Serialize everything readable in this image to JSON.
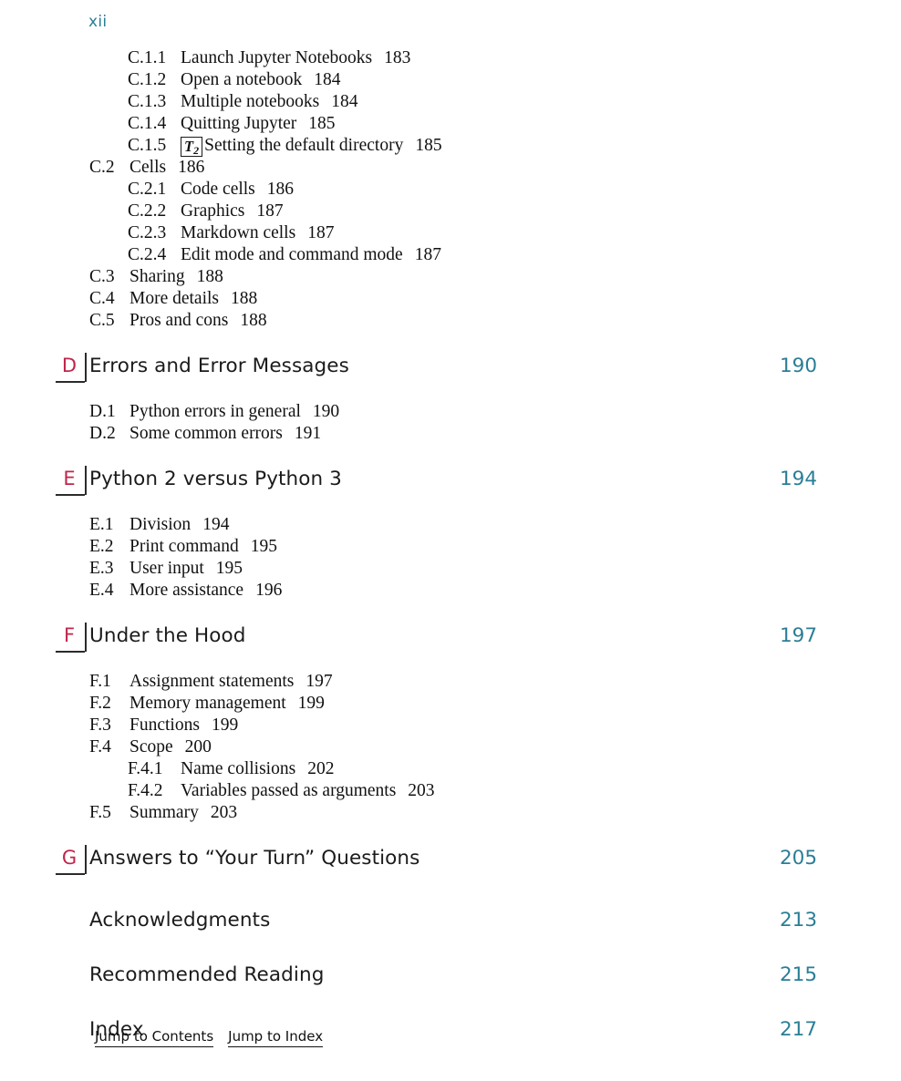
{
  "folio": "xii",
  "appendix_c_continued": [
    {
      "level": 3,
      "number": "C.1.1",
      "title": "Launch Jupyter Notebooks",
      "page": "183"
    },
    {
      "level": 3,
      "number": "C.1.2",
      "title": "Open a notebook",
      "page": "184"
    },
    {
      "level": 3,
      "number": "C.1.3",
      "title": "Multiple notebooks",
      "page": "184"
    },
    {
      "level": 3,
      "number": "C.1.4",
      "title": "Quitting Jupyter",
      "page": "185"
    },
    {
      "level": 3,
      "number": "C.1.5",
      "badge": "T2",
      "title": "Setting the default directory",
      "page": "185"
    },
    {
      "level": 2,
      "number": "C.2",
      "title": "Cells",
      "page": "186"
    },
    {
      "level": 3,
      "number": "C.2.1",
      "title": "Code cells",
      "page": "186"
    },
    {
      "level": 3,
      "number": "C.2.2",
      "title": "Graphics",
      "page": "187"
    },
    {
      "level": 3,
      "number": "C.2.3",
      "title": "Markdown cells",
      "page": "187"
    },
    {
      "level": 3,
      "number": "C.2.4",
      "title": "Edit mode and command mode",
      "page": "187"
    },
    {
      "level": 2,
      "number": "C.3",
      "title": "Sharing",
      "page": "188"
    },
    {
      "level": 2,
      "number": "C.4",
      "title": "More details",
      "page": "188"
    },
    {
      "level": 2,
      "number": "C.5",
      "title": "Pros and cons",
      "page": "188"
    }
  ],
  "chapters": [
    {
      "letter": "D",
      "title": "Errors and Error Messages",
      "page": "190",
      "sections": [
        {
          "level": 2,
          "number": "D.1",
          "title": "Python errors in general",
          "page": "190"
        },
        {
          "level": 2,
          "number": "D.2",
          "title": "Some common errors",
          "page": "191"
        }
      ]
    },
    {
      "letter": "E",
      "title": "Python 2 versus Python 3",
      "page": "194",
      "sections": [
        {
          "level": 2,
          "number": "E.1",
          "title": "Division",
          "page": "194"
        },
        {
          "level": 2,
          "number": "E.2",
          "title": "Print command",
          "page": "195"
        },
        {
          "level": 2,
          "number": "E.3",
          "title": "User input",
          "page": "195"
        },
        {
          "level": 2,
          "number": "E.4",
          "title": "More assistance",
          "page": "196"
        }
      ]
    },
    {
      "letter": "F",
      "title": "Under the Hood",
      "page": "197",
      "sections": [
        {
          "level": 2,
          "number": "F.1",
          "title": "Assignment statements",
          "page": "197"
        },
        {
          "level": 2,
          "number": "F.2",
          "title": "Memory management",
          "page": "199"
        },
        {
          "level": 2,
          "number": "F.3",
          "title": "Functions",
          "page": "199"
        },
        {
          "level": 2,
          "number": "F.4",
          "title": "Scope",
          "page": "200"
        },
        {
          "level": 3,
          "number": "F.4.1",
          "title": "Name collisions",
          "page": "202"
        },
        {
          "level": 3,
          "number": "F.4.2",
          "title": "Variables passed as arguments",
          "page": "203"
        },
        {
          "level": 2,
          "number": "F.5",
          "title": "Summary",
          "page": "203"
        }
      ]
    },
    {
      "letter": "G",
      "title": "Answers to “Your Turn” Questions",
      "page": "205",
      "sections": []
    }
  ],
  "back_matter": [
    {
      "title": "Acknowledgments",
      "page": "213"
    },
    {
      "title": "Recommended Reading",
      "page": "215"
    },
    {
      "title": "Index",
      "page": "217"
    }
  ],
  "footer": {
    "jump_to_contents": "Jump to Contents",
    "jump_to_index": "Jump to Index"
  },
  "colors": {
    "folio": "#2a7e96",
    "page_number": "#2a7e96",
    "chapter_letter": "#c0264a",
    "text": "#111111"
  }
}
